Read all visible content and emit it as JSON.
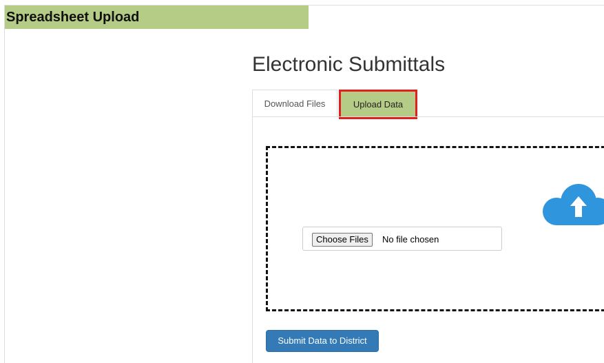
{
  "header": {
    "section_title": "Spreadsheet Upload"
  },
  "main": {
    "title": "Electronic Submittals",
    "tabs": [
      {
        "label": "Download Files",
        "active": false
      },
      {
        "label": "Upload Data",
        "active": true
      }
    ],
    "upload": {
      "icon": "cloud-upload-icon",
      "choose_button_label": "Choose Files",
      "file_status": "No file chosen"
    },
    "submit_label": "Submit Data to District"
  },
  "colors": {
    "header_bg": "#b5cc86",
    "active_tab_bg": "#b5cc86",
    "highlight_border": "#e02020",
    "primary_button": "#337ab7",
    "cloud_icon": "#2f95dc"
  }
}
